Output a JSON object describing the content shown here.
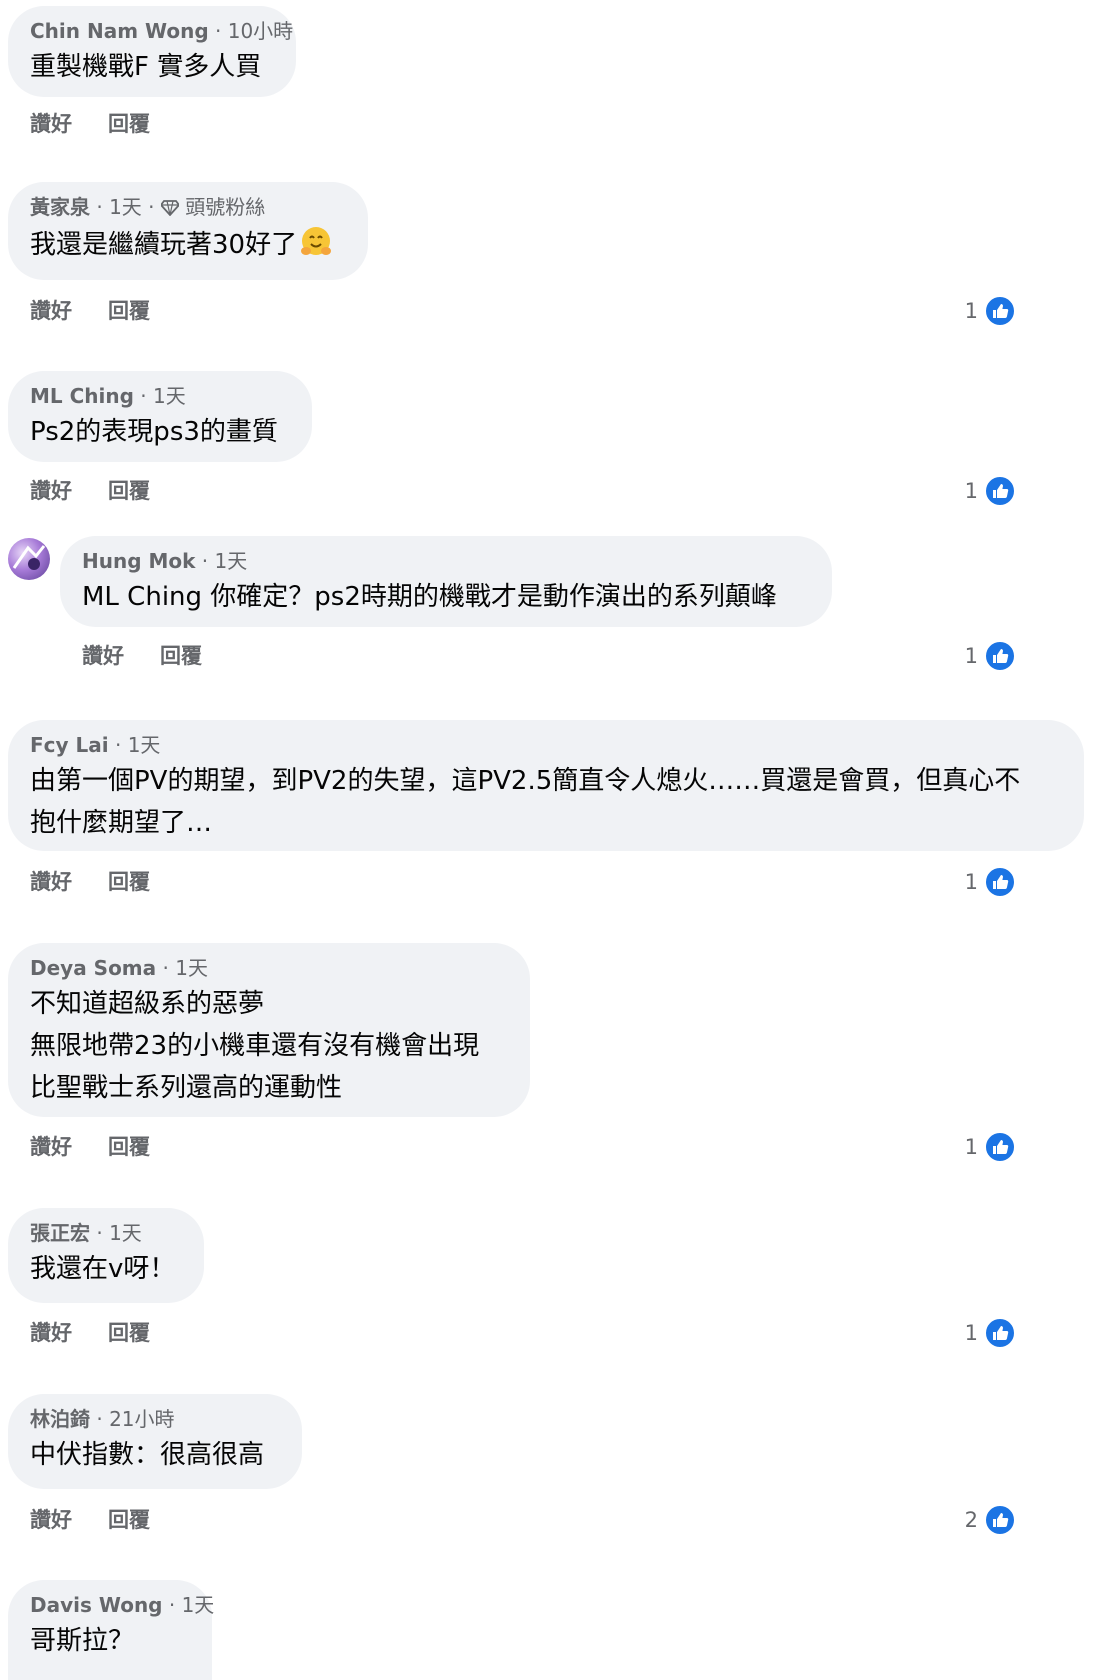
{
  "actions": {
    "like_label": "讚好",
    "reply_label": "回覆"
  },
  "comments": [
    {
      "author": "Chin Nam Wong",
      "time": "10小時",
      "text": "重製機戰F 實多人買",
      "likes": null
    },
    {
      "author": "黃家泉",
      "time": "1天",
      "badge": "頭號粉絲",
      "text": "我還是繼續玩著30好了",
      "likes": "1"
    },
    {
      "author": "ML Ching",
      "time": "1天",
      "text": "Ps2的表現ps3的畫質",
      "likes": "1"
    },
    {
      "author": "Hung Mok",
      "time": "1天",
      "text": "ML Ching 你確定？ps2時期的機戰才是動作演出的系列顛峰",
      "likes": "1"
    },
    {
      "author": "Fcy Lai",
      "time": "1天",
      "text": "由第一個PV的期望，到PV2的失望，這PV2.5簡直令人熄火……買還是會買，但真心不抱什麼期望了…",
      "likes": "1"
    },
    {
      "author": "Deya Soma",
      "time": "1天",
      "lines": [
        "不知道超級系的惡夢",
        "無限地帶23的小機車還有沒有機會出現",
        "比聖戰士系列還高的運動性"
      ],
      "likes": "1"
    },
    {
      "author": "張正宏",
      "time": "1天",
      "text": "我還在v呀！",
      "likes": "1"
    },
    {
      "author": "林泊錡",
      "time": "21小時",
      "text": "中伏指數：很高很高",
      "likes": "2"
    },
    {
      "author": "Davis Wong",
      "time": "1天",
      "text": "哥斯拉？",
      "likes": null
    }
  ]
}
